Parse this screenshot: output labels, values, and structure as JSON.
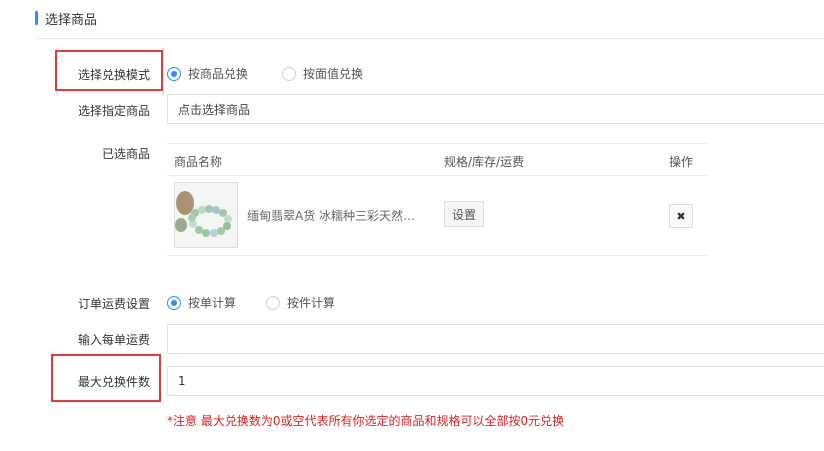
{
  "section": {
    "title": "选择商品"
  },
  "exchange_mode": {
    "label": "选择兑换模式",
    "options": [
      {
        "label": "按商品兑换",
        "checked": true
      },
      {
        "label": "按面值兑换",
        "checked": false
      }
    ]
  },
  "choose_goods": {
    "label": "选择指定商品",
    "button_text": "点击选择商品"
  },
  "selected_goods": {
    "label": "已选商品",
    "columns": {
      "name": "商品名称",
      "spec": "规格/库存/运费",
      "action": "操作"
    },
    "rows": [
      {
        "name": "缅甸翡翠A货 冰糯种三彩天然翡翠手镯",
        "set_label": "设置",
        "delete_icon": "close-icon"
      }
    ]
  },
  "freight_setting": {
    "label": "订单运费设置",
    "options": [
      {
        "label": "按单计算",
        "checked": true
      },
      {
        "label": "按件计算",
        "checked": false
      }
    ]
  },
  "per_order_freight": {
    "label": "输入每单运费",
    "value": ""
  },
  "max_exchange": {
    "label": "最大兑换件数",
    "value": "1"
  },
  "note": "*注意 最大兑换数为0或空代表所有你选定的商品和规格可以全部按0元兑换",
  "colors": {
    "accent": "#2b8eff",
    "highlight_box": "#e53935",
    "note": "#e02020"
  }
}
